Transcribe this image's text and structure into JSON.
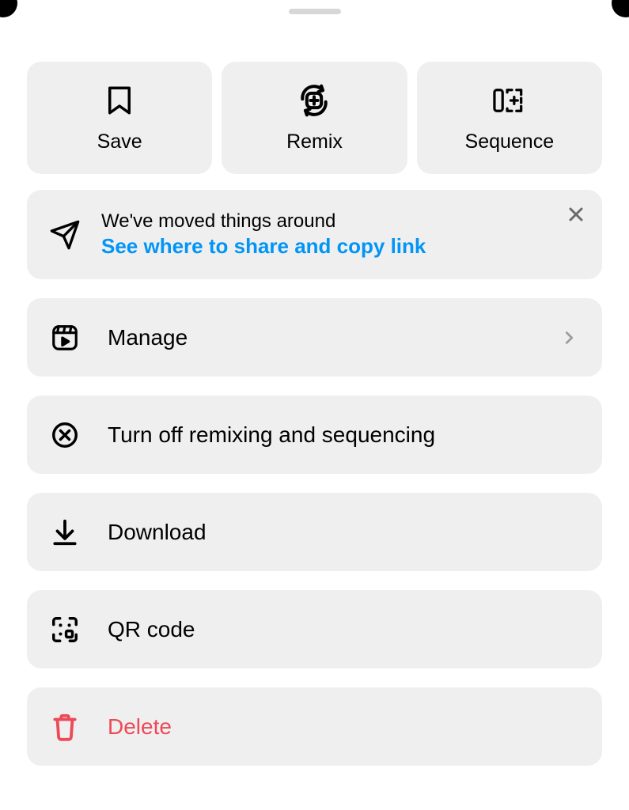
{
  "top_actions": {
    "save": "Save",
    "remix": "Remix",
    "sequence": "Sequence"
  },
  "banner": {
    "title": "We've moved things around",
    "link": "See where to share and copy link"
  },
  "rows": {
    "manage": "Manage",
    "turnoff": "Turn off remixing and sequencing",
    "download": "Download",
    "qrcode": "QR code",
    "delete": "Delete"
  }
}
